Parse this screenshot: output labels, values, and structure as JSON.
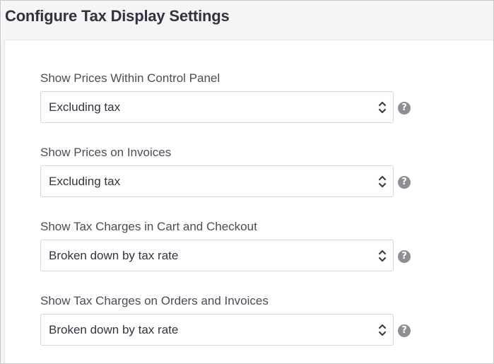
{
  "title": "Configure Tax Display Settings",
  "fields": [
    {
      "label": "Show Prices Within Control Panel",
      "value": "Excluding tax"
    },
    {
      "label": "Show Prices on Invoices",
      "value": "Excluding tax"
    },
    {
      "label": "Show Tax Charges in Cart and Checkout",
      "value": "Broken down by tax rate"
    },
    {
      "label": "Show Tax Charges on Orders and Invoices",
      "value": "Broken down by tax rate"
    }
  ],
  "help_glyph": "?",
  "icons": {
    "select_arrows": "up-down-chevron-icon",
    "help": "question-circle-icon"
  },
  "colors": {
    "title": "#313440",
    "label": "#4a4d58",
    "help_bg": "#8e8f96",
    "panel_bg": "#ffffff",
    "page_bg": "#f5f5f6"
  }
}
